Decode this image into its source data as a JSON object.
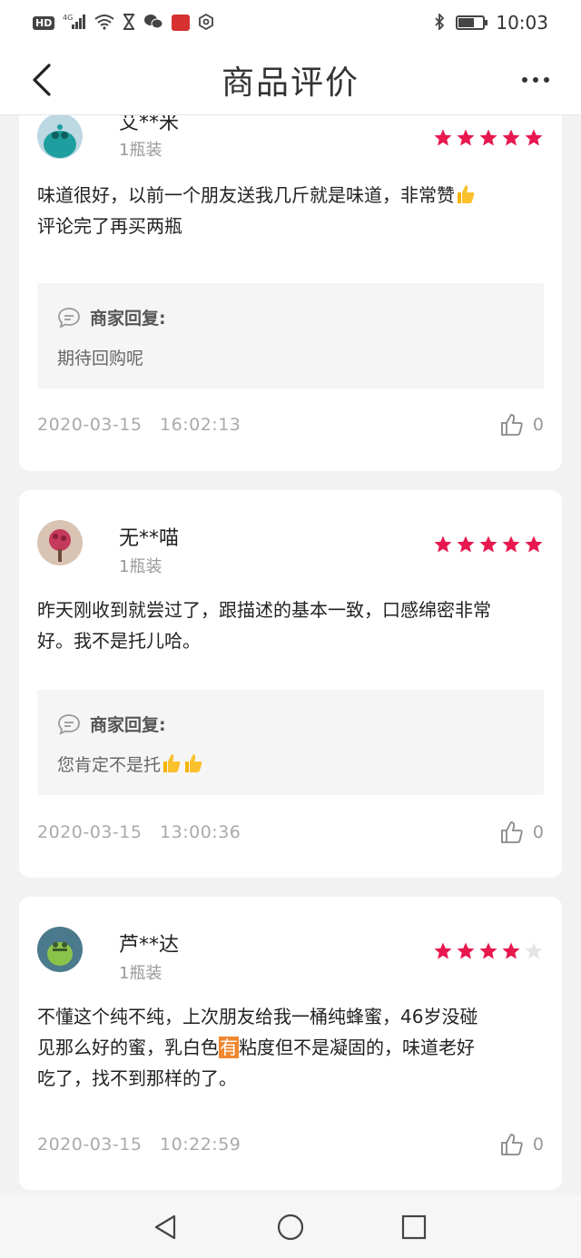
{
  "status_bar": {
    "time": "10:03",
    "hd": "HD",
    "network": "4G",
    "icons": [
      "hd-icon",
      "signal-icon",
      "wifi-icon",
      "hourglass-icon",
      "wechat-icon",
      "app-badge-icon",
      "settings-icon",
      "bluetooth-icon",
      "battery-icon"
    ]
  },
  "header": {
    "title": "商品评价",
    "back_icon": "chevron-left-icon",
    "more_icon": "more-dots-icon"
  },
  "reviews": [
    {
      "username": "艾**米",
      "spec": "1瓶装",
      "rating": 5,
      "max_rating": 5,
      "text_parts": [
        "味道很好，以前一个朋友送我几斤就是味道，非常赞",
        "👍",
        "评论完了再买两瓶"
      ],
      "reply_label": "商家回复:",
      "reply_text": "期待回购呢",
      "date": "2020-03-15",
      "time": "16:02:13",
      "likes": "0",
      "avatar_color": "#1e9e9e"
    },
    {
      "username": "无**喵",
      "spec": "1瓶装",
      "rating": 5,
      "max_rating": 5,
      "text_parts": [
        "昨天刚收到就尝过了，跟描述的基本一致，口感绵密非常",
        "好。我不是托儿哈。"
      ],
      "reply_label": "商家回复:",
      "reply_text": "您肯定不是托",
      "reply_emoji": "👍👍",
      "date": "2020-03-15",
      "time": "13:00:36",
      "likes": "0",
      "avatar_color": "#c43a5a"
    },
    {
      "username": "芦**达",
      "spec": "1瓶装",
      "rating": 4,
      "max_rating": 5,
      "text_parts": [
        "不懂这个纯不纯，上次朋友给我一桶纯蜂蜜，46岁没碰",
        "见那么好的蜜，乳白色",
        "有",
        "粘度但不是凝固的，味道老好",
        "吃了，找不到那样的了。"
      ],
      "date": "2020-03-15",
      "time": "10:22:59",
      "likes": "0",
      "avatar_color": "#4a7a8c"
    }
  ],
  "colors": {
    "star_active": "#e8184f",
    "star_inactive": "#e5e5e5",
    "highlight": "#f0862e",
    "background": "#f2f2f2"
  },
  "nav_bar": {
    "icons": [
      "back-triangle-icon",
      "home-circle-icon",
      "recents-square-icon"
    ]
  }
}
